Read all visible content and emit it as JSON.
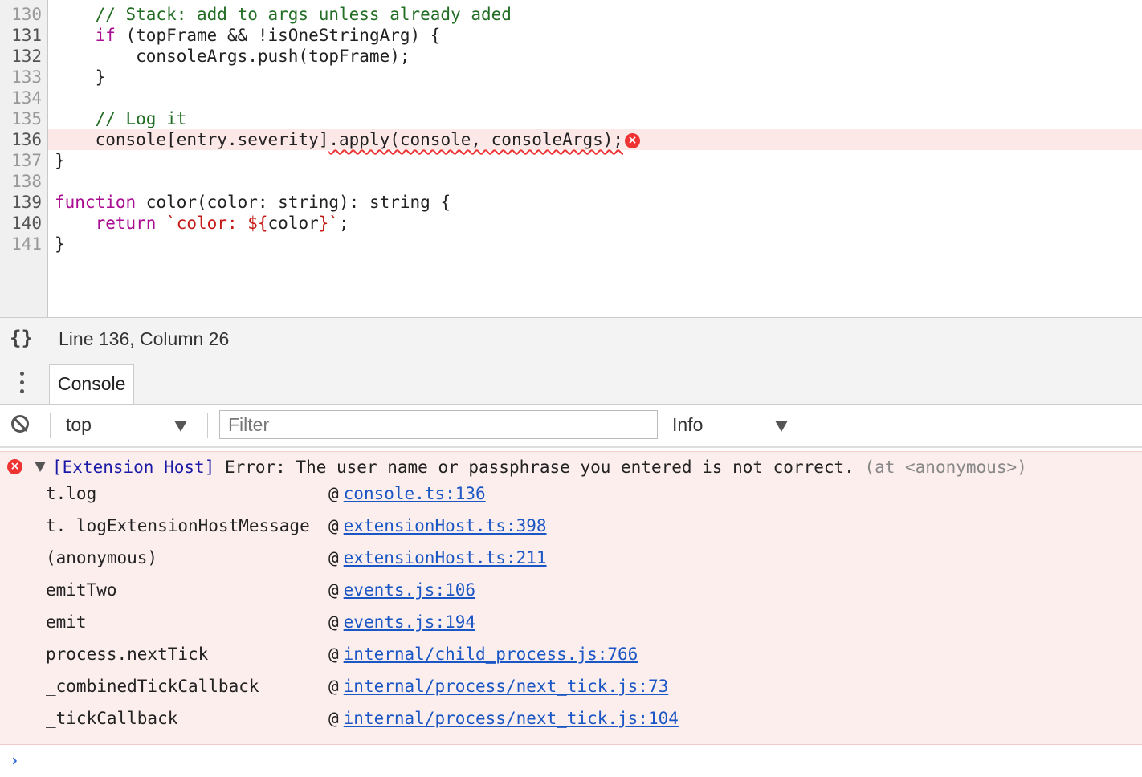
{
  "editor": {
    "lines": [
      {
        "num": "130",
        "tokens": [
          {
            "t": "    // Stack: add to args unless already aded",
            "c": "comment"
          }
        ]
      },
      {
        "num": "131",
        "tokens": [
          {
            "t": "    ",
            "c": "plain"
          },
          {
            "t": "if",
            "c": "kw"
          },
          {
            "t": " (topFrame && !isOneStringArg) {",
            "c": "plain"
          }
        ]
      },
      {
        "num": "132",
        "tokens": [
          {
            "t": "        consoleArgs.push(topFrame);",
            "c": "plain"
          }
        ]
      },
      {
        "num": "133",
        "tokens": [
          {
            "t": "    }",
            "c": "plain"
          }
        ]
      },
      {
        "num": "134",
        "tokens": []
      },
      {
        "num": "135",
        "tokens": [
          {
            "t": "    // Log it",
            "c": "comment"
          }
        ]
      },
      {
        "num": "136",
        "tokens": [
          {
            "t": "    console[entry.severity]",
            "c": "plain"
          },
          {
            "t": ".apply(console, consoleArgs);",
            "c": "plain",
            "squiggle": true
          }
        ],
        "error": true
      },
      {
        "num": "137",
        "tokens": [
          {
            "t": "}",
            "c": "plain"
          }
        ]
      },
      {
        "num": "138",
        "tokens": []
      },
      {
        "num": "139",
        "tokens": [
          {
            "t": "function",
            "c": "kw"
          },
          {
            "t": " color(color: string): string {",
            "c": "plain"
          }
        ]
      },
      {
        "num": "140",
        "tokens": [
          {
            "t": "    ",
            "c": "plain"
          },
          {
            "t": "return",
            "c": "kw"
          },
          {
            "t": " ",
            "c": "plain"
          },
          {
            "t": "`color: ${",
            "c": "str"
          },
          {
            "t": "color",
            "c": "plain"
          },
          {
            "t": "}`",
            "c": "str"
          },
          {
            "t": ";",
            "c": "plain"
          }
        ]
      },
      {
        "num": "141",
        "tokens": [
          {
            "t": "}",
            "c": "plain"
          }
        ]
      }
    ],
    "dark_line_nums": [
      "131",
      "132",
      "136",
      "139",
      "140"
    ]
  },
  "statusbar": {
    "format_icon": "{}",
    "cursor_position": "Line 136, Column 26"
  },
  "drawer": {
    "tab_label": "Console"
  },
  "toolbar": {
    "context": "top",
    "filter_placeholder": "Filter",
    "level": "Info"
  },
  "console": {
    "error": {
      "source": "[Extension Host]",
      "text": " Error: The user name or passphrase you entered is not correct. ",
      "location": "(at <anonymous>)",
      "stack": [
        {
          "fn": "t.log",
          "link": "console.ts:136"
        },
        {
          "fn": "t._logExtensionHostMessage",
          "link": "extensionHost.ts:398"
        },
        {
          "fn": "(anonymous)",
          "link": "extensionHost.ts:211"
        },
        {
          "fn": "emitTwo",
          "link": "events.js:106"
        },
        {
          "fn": "emit",
          "link": "events.js:194"
        },
        {
          "fn": "process.nextTick",
          "link": "internal/child_process.js:766"
        },
        {
          "fn": "_combinedTickCallback",
          "link": "internal/process/next_tick.js:73"
        },
        {
          "fn": "_tickCallback",
          "link": "internal/process/next_tick.js:104"
        }
      ]
    },
    "at_symbol": "@",
    "prompt": "›"
  },
  "colors": {
    "comment": "#236e25",
    "keyword": "#aa0d91",
    "string": "#c41a16",
    "error": "#e33333",
    "link": "#1a57c4",
    "error_bg": "#fdeeee"
  }
}
